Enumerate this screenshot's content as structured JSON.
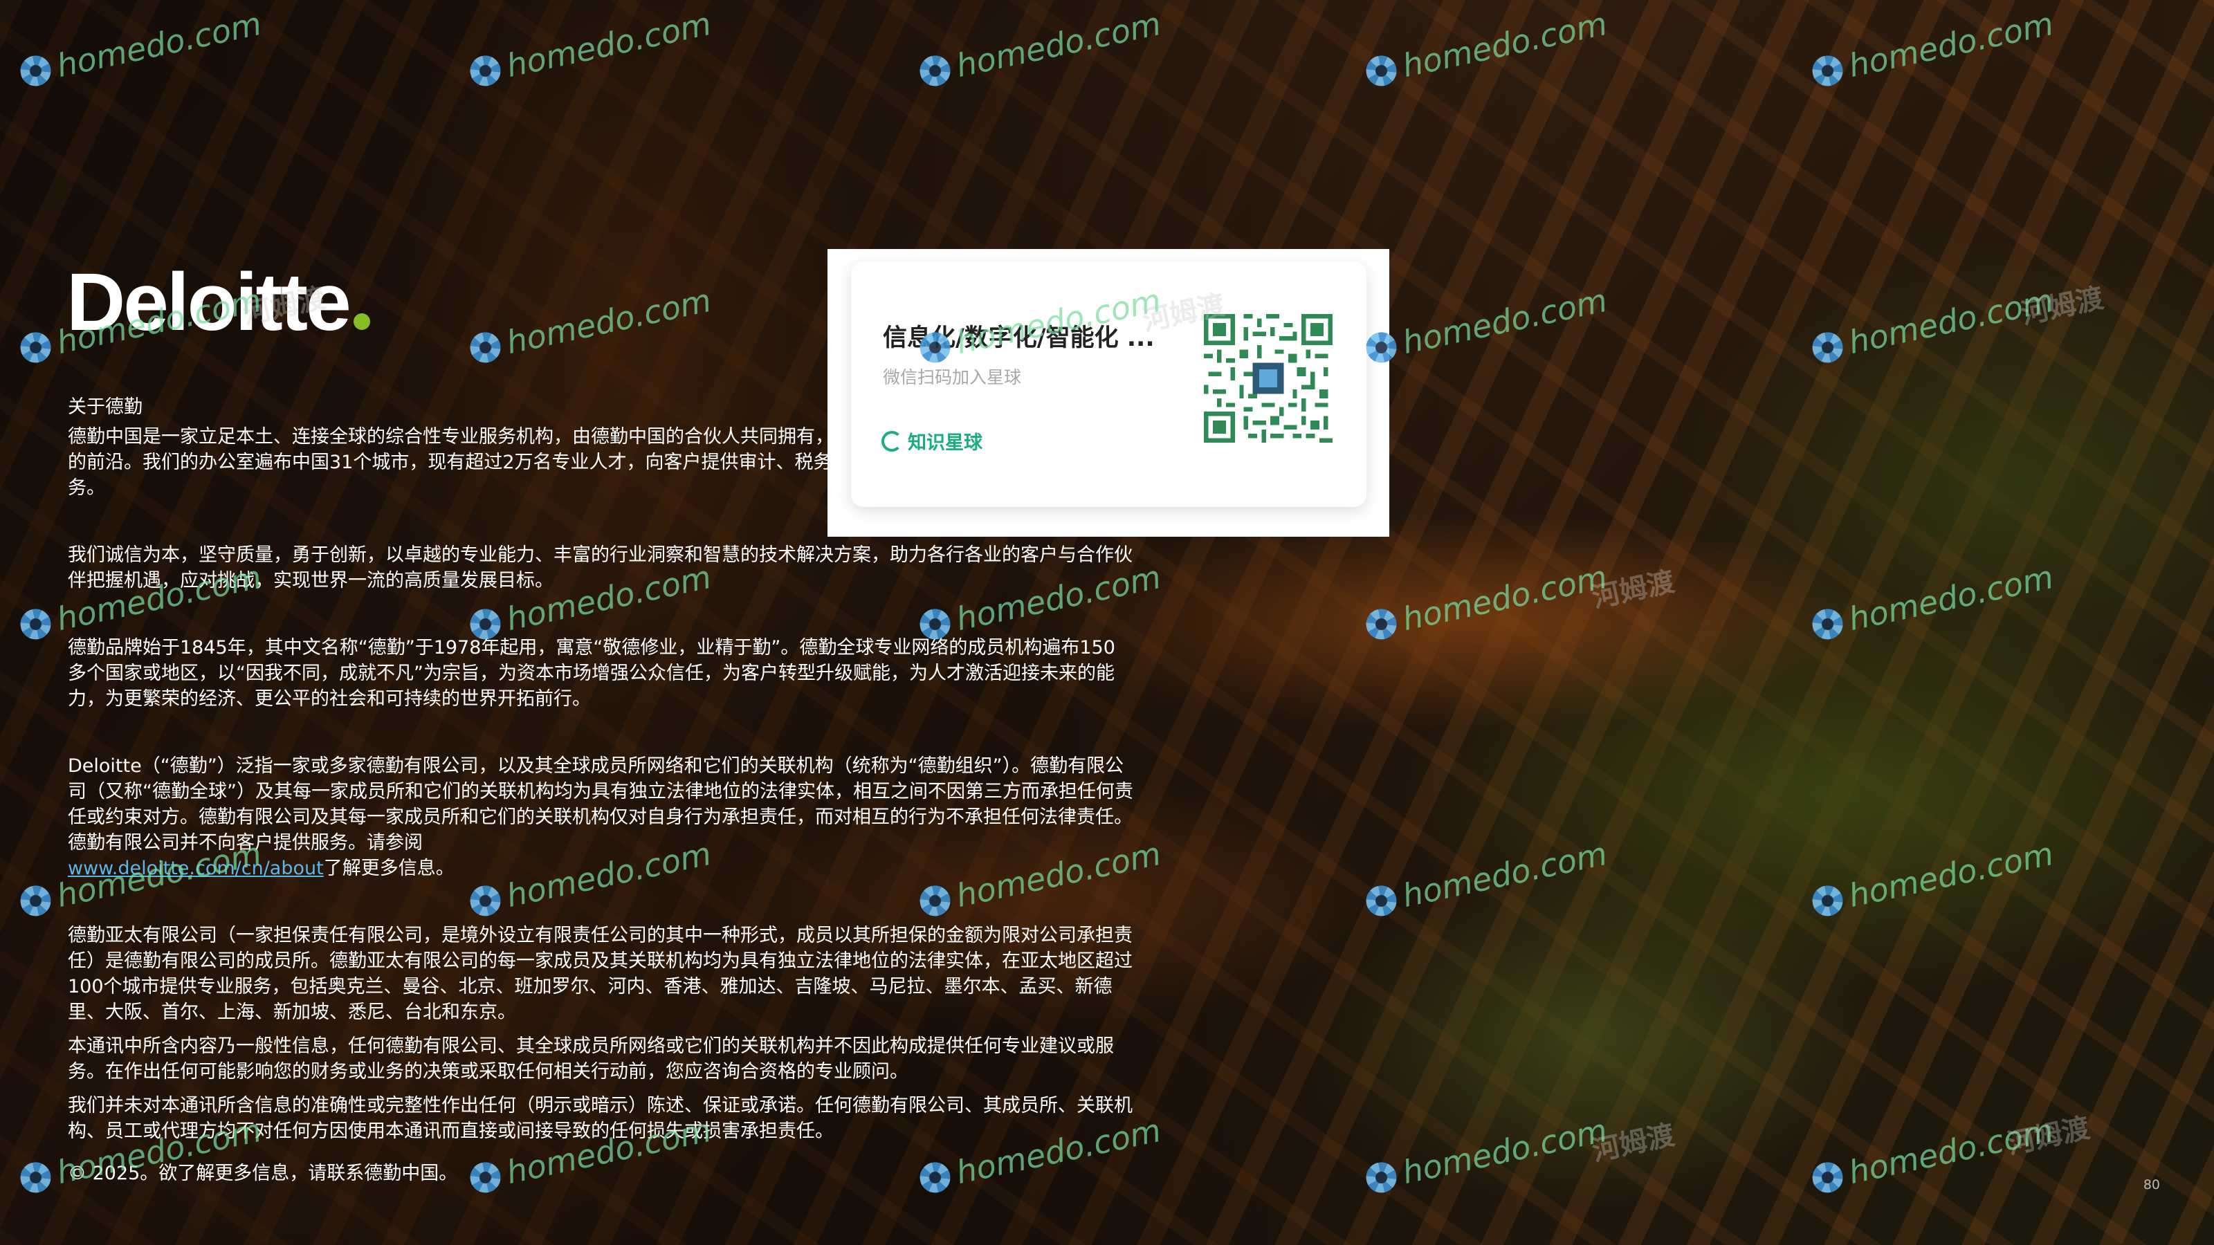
{
  "brand": {
    "logo_text": "Deloitte",
    "accent_color": "#86bc25"
  },
  "about": {
    "heading": "关于德勤",
    "paragraphs": [
      "德勤中国是一家立足本土、连接全球的综合性专业服务机构，由德勤中国的合伙人共同拥有，始终服务于中国改革开放和经济建设的前沿。我们的办公室遍布中国31个城市，现有超过2万名专业人才，向客户提供审计、税务、咨询等全球领先的一站式专业服务。",
      "我们诚信为本，坚守质量，勇于创新，以卓越的专业能力、丰富的行业洞察和智慧的技术解决方案，助力各行各业的客户与合作伙伴把握机遇，应对挑战，实现世界一流的高质量发展目标。",
      "德勤品牌始于1845年，其中文名称“德勤”于1978年起用，寓意“敬德修业，业精于勤”。德勤全球专业网络的成员机构遍布150多个国家或地区，以“因我不同，成就不凡”为宗旨，为资本市场增强公众信任，为客户转型升级赋能，为人才激活迎接未来的能力，为更繁荣的经济、更公平的社会和可持续的世界开拓前行。"
    ],
    "legal_paragraph": "Deloitte（“德勤”）泛指一家或多家德勤有限公司，以及其全球成员所网络和它们的关联机构（统称为“德勤组织”）。德勤有限公司（又称“德勤全球”）及其每一家成员所和它们的关联机构均为具有独立法律地位的法律实体，相互之间不因第三方而承担任何责任或约束对方。德勤有限公司及其每一家成员所和它们的关联机构仅对自身行为承担责任，而对相互的行为不承担任何法律责任。德勤有限公司并不向客户提供服务。请参阅",
    "link_text": "www.deloitte.com/cn/about",
    "link_suffix": "了解更多信息。",
    "asia_pacific": "德勤亚太有限公司（一家担保责任有限公司，是境外设立有限责任公司的其中一种形式，成员以其所担保的金额为限对公司承担责任）是德勤有限公司的成员所。德勤亚太有限公司的每一家成员及其关联机构均为具有独立法律地位的法律实体，在亚太地区超过100个城市提供专业服务，包括奥克兰、曼谷、北京、班加罗尔、河内、香港、雅加达、吉隆坡、马尼拉、墨尔本、孟买、新德里、大阪、首尔、上海、新加坡、悉尼、台北和东京。",
    "disclaimer_1": "本通讯中所含内容乃一般性信息，任何德勤有限公司、其全球成员所网络或它们的关联机构并不因此构成提供任何专业建议或服务。在作出任何可能影响您的财务或业务的决策或采取任何相关行动前，您应咨询合资格的专业顾问。",
    "disclaimer_2": "我们并未对本通讯所含信息的准确性或完整性作出任何（明示或暗示）陈述、保证或承诺。任何德勤有限公司、其成员所、关联机构、员工或代理方均不对任何方因使用本通讯而直接或间接导致的任何损失或损害承担责任。",
    "copyright": "© 2025。欲了解更多信息，请联系德勤中国。"
  },
  "card": {
    "title": "信息化/数字化/智能化 ...",
    "subtitle": "微信扫码加入星球",
    "brand_label": "知识星球",
    "brand_color": "#1aaf7a"
  },
  "page_number": "80",
  "watermark": {
    "text": "homedo.com",
    "cn_text": "河姆渡"
  }
}
